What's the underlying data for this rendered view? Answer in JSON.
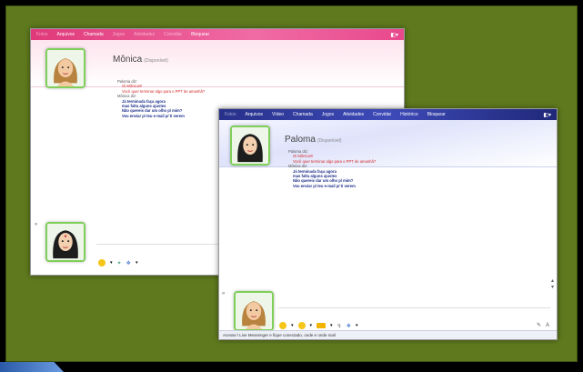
{
  "menu_pink": [
    "Fotos",
    "Arquivos",
    "Chamada",
    "Jogos",
    "Atividades",
    "Convidar",
    "Bloquear"
  ],
  "menu_blue": [
    "Fotos",
    "Arquivos",
    "Vídeo",
    "Chamada",
    "Jogos",
    "Atividades",
    "Convidar",
    "Histórico",
    "Bloquear"
  ],
  "pink_window": {
    "contact_name": "Mônica",
    "contact_status": "(Disponível)",
    "sender_paloma": "Paloma diz:",
    "paloma_msgs": [
      "Oi Mônica!!!",
      "Você quer terminar algo para o PPT de amanhã?"
    ],
    "sender_monica": "Mônica diz:",
    "monica_msgs": [
      "Já terminada faça agora",
      "mas falta alguns ajustes",
      "Não quereis dar um olho p/ mim?",
      "Vou enviar p/ teu e-mail p/ ti verem"
    ]
  },
  "blue_window": {
    "contact_name": "Paloma",
    "contact_status": "(Disponível)",
    "sender_paloma": "Paloma diz:",
    "paloma_msgs": [
      "Oi Mônica!!!",
      "Você quer terminar algo para o PPT de amanhã?"
    ],
    "sender_monica": "Mônica diz:",
    "monica_msgs": [
      "Já terminada faça agora",
      "mas falta alguns ajustes",
      "Não quereis dar um olho p/ mim?",
      "Vou enviar p/ teu e-mail p/ ti verem"
    ],
    "status_text": "Acesse l Live Messenger e fique conectado, onde e onde mail"
  },
  "colors": {
    "desktop": "#5f7a1e",
    "pink_title": "#e0397a",
    "blue_title": "#27318a",
    "paloma_text": "#d22a2a",
    "monica_text": "#1c2f8a"
  }
}
